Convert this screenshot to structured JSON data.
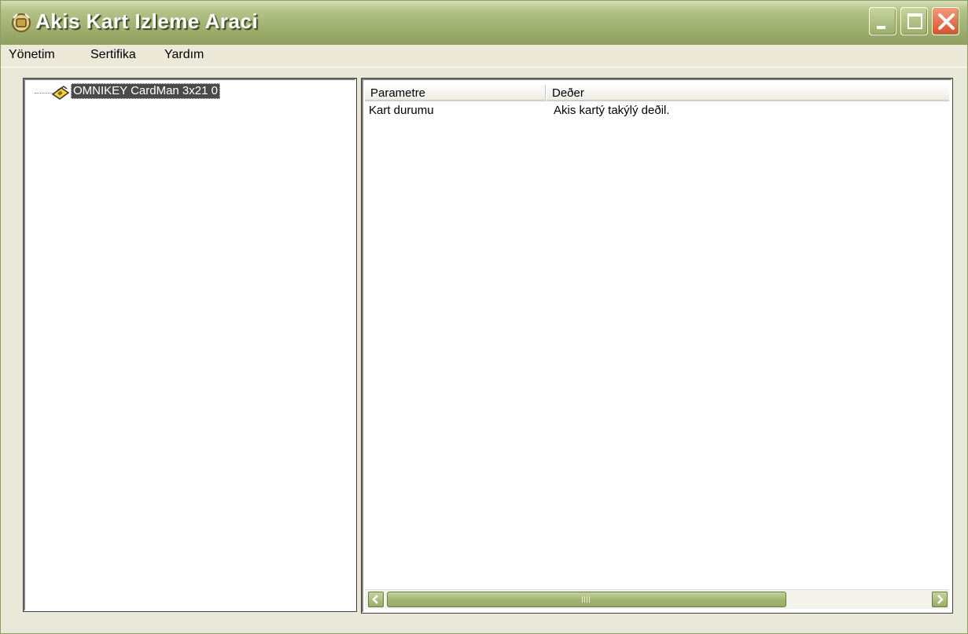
{
  "window": {
    "title": "Akis Kart Izleme Araci",
    "accent_color": "#A3B373",
    "app_icon": "smartcard-app-icon",
    "controls": [
      "minimize-icon",
      "maximize-icon",
      "close-icon"
    ]
  },
  "menubar": {
    "items": [
      {
        "label": "Yönetim"
      },
      {
        "label": "Sertifika"
      },
      {
        "label": "Yardım"
      }
    ]
  },
  "tree": {
    "nodes": [
      {
        "label": "OMNIKEY CardMan 3x21 0",
        "icon": "card-reader-icon",
        "selected": true
      }
    ]
  },
  "details": {
    "columns": [
      "Parametre",
      "Deðer"
    ],
    "rows": [
      {
        "param": "Kart durumu",
        "value": "Akis kartý takýlý deðil."
      }
    ]
  },
  "scrollbar": {
    "left_icon": "arrow-left-icon",
    "right_icon": "arrow-right-icon"
  }
}
